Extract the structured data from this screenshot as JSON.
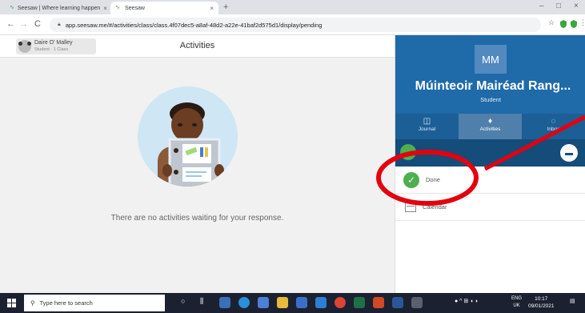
{
  "browser": {
    "tabs": [
      {
        "label": "Seesaw | Where learning happen",
        "close": "×"
      },
      {
        "label": "Seesaw",
        "close": "×"
      }
    ],
    "new_tab": "+",
    "window_controls": {
      "minimize": "–",
      "maximize": "□",
      "close": "×"
    },
    "url": "app.seesaw.me/#/activities/class/class.4f07dec5-a8af-48d2-a22e-41baf2d575d1/display/pending",
    "nav": {
      "back": "←",
      "forward": "→",
      "reload": "C"
    }
  },
  "header": {
    "user_name": "Daire O' Malley",
    "user_sub": "Student · 1 Class",
    "page_title": "Activities"
  },
  "main": {
    "empty_message": "There are no activities waiting for your response."
  },
  "panel": {
    "initials": "MM",
    "teacher_name": "Múinteoir Mairéad Rang...",
    "role": "Student",
    "tabs": [
      {
        "label": "Journal",
        "icon": "journal-icon"
      },
      {
        "label": "Activities",
        "icon": "lightbulb-icon"
      },
      {
        "label": "Inbox",
        "icon": "inbox-icon"
      }
    ],
    "items": [
      {
        "label": "Done",
        "icon": "check-circle-icon"
      },
      {
        "label": "Calendar",
        "icon": "calendar-icon"
      }
    ]
  },
  "annotation": {
    "color": "#e3000f"
  },
  "taskbar": {
    "search_placeholder": "Type here to search",
    "lang_top": "ENG",
    "lang_bottom": "UK",
    "time": "10:17",
    "date": "09/01/2021"
  },
  "colors": {
    "panel_blue": "#1f6aa8",
    "done_green": "#4caf50"
  }
}
